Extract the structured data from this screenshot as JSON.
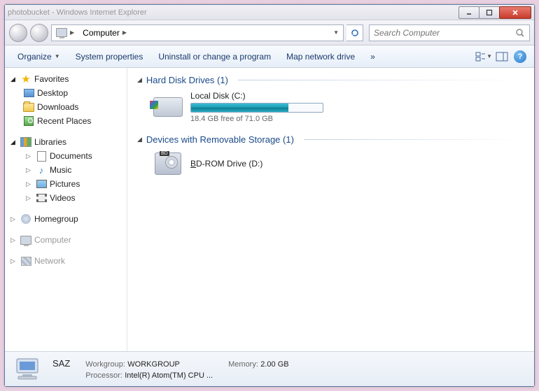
{
  "titlebar": {
    "title": "photobucket - Windows Internet Explorer"
  },
  "address": {
    "root_label": "Computer"
  },
  "search": {
    "placeholder": "Search Computer"
  },
  "toolbar": {
    "organize": "Organize",
    "sysprops": "System properties",
    "uninstall": "Uninstall or change a program",
    "mapdrive": "Map network drive",
    "overflow": "»"
  },
  "sidebar": {
    "favorites": {
      "label": "Favorites",
      "desktop": "Desktop",
      "downloads": "Downloads",
      "recent": "Recent Places"
    },
    "libraries": {
      "label": "Libraries",
      "documents": "Documents",
      "music": "Music",
      "pictures": "Pictures",
      "videos": "Videos"
    },
    "homegroup": "Homegroup",
    "computer": "Computer",
    "network": "Network"
  },
  "content": {
    "hdd_group": "Hard Disk Drives (1)",
    "local_disk": {
      "name": "Local Disk (C:)",
      "free": "18.4 GB free of 71.0 GB",
      "used_pct": 74
    },
    "removable_group": "Devices with Removable Storage (1)",
    "bdrom": {
      "prefix": "B",
      "rest": "D-ROM Drive (D:)"
    }
  },
  "status": {
    "name": "SAZ",
    "workgroup_lbl": "Workgroup:",
    "workgroup": "WORKGROUP",
    "memory_lbl": "Memory:",
    "memory": "2.00 GB",
    "processor_lbl": "Processor:",
    "processor": "Intel(R) Atom(TM) CPU ..."
  }
}
